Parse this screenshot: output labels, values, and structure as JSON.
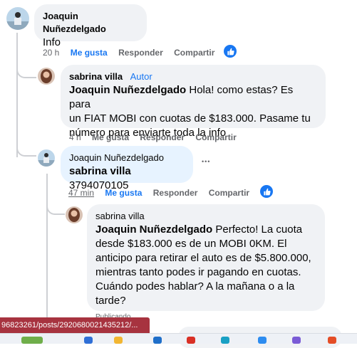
{
  "comments": [
    {
      "author": "Joaquin Nuñezdelgado",
      "text": "Info",
      "time": "20 h",
      "like_label": "Me gusta",
      "reply_label": "Responder",
      "share_label": "Compartir",
      "liked": true
    },
    {
      "author": "sabrina villa",
      "badge": "Autor",
      "mention": "Joaquin Nuñezdelgado",
      "text_line1": "Hola! como estas? Es para",
      "text_line2": "un FIAT MOBI con cuotas de $183.000. Pasame tu",
      "text_line3": "número para enviarte toda la info",
      "time": "4 h",
      "like_label": "Me gusta",
      "reply_label": "Responder",
      "share_label": "Compartir"
    },
    {
      "author": "Joaquin Nuñezdelgado",
      "mention": "sabrina villa",
      "text": "3794070105",
      "time": "47 min",
      "like_label": "Me gusta",
      "reply_label": "Responder",
      "share_label": "Compartir",
      "liked": true,
      "more": "•••"
    },
    {
      "author": "sabrina villa",
      "mention": "Joaquin Nuñezdelgado",
      "text_line1": "Perfecto! La cuota",
      "text_line2": "desde $183.000 es de un MOBI 0KM. El",
      "text_line3": "anticipo para retirar el auto es de $5.800.000,",
      "text_line4": "mientras tanto podes ir pagando en cuotas.",
      "text_line5": "Cuándo podes hablar? A la mañana o a la",
      "text_line6": "tarde?",
      "time_partial": "Publicando"
    }
  ],
  "status_bar": {
    "url": "96823261/posts/2920680021435212/..."
  },
  "colors": {
    "accent": "#1877f2",
    "bubble": "#f0f2f5",
    "bubble_highlight": "#e7f3ff",
    "status_bg": "#a7333f"
  }
}
